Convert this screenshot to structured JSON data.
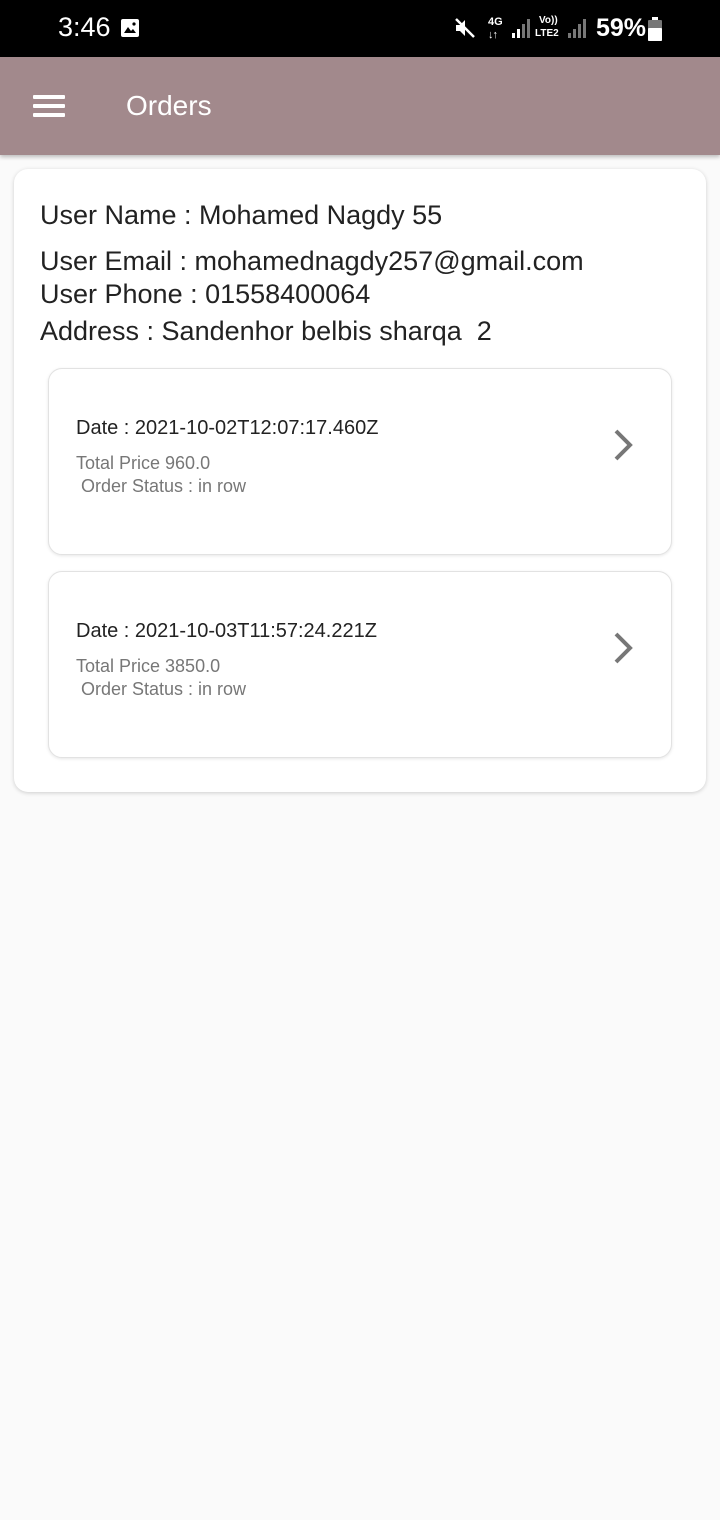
{
  "status_bar": {
    "time": "3:46",
    "network_type": "4G",
    "network_arrows": "↓↑",
    "volte_top": "Vo))",
    "volte_bottom": "LTE2",
    "battery": "59%",
    "icons": [
      "gallery-icon",
      "mute-icon",
      "signal-icon",
      "battery-icon"
    ]
  },
  "app_bar": {
    "title": "Orders",
    "menu_icon": "hamburger-menu-icon",
    "color": "#a2898c"
  },
  "user": {
    "name_line": "User Name : Mohamed Nagdy 55",
    "email_line": "User Email : mohamednagdy257@gmail.com",
    "phone_line": "User Phone : 01558400064",
    "address_line": "Address : Sandenhor belbis sharqa  2"
  },
  "orders": [
    {
      "date": "Date : 2021-10-02T12:07:17.460Z",
      "price": "Total Price 960.0",
      "status": " Order Status : in row",
      "icon": "chevron-right-icon"
    },
    {
      "date": "Date : 2021-10-03T11:57:24.221Z",
      "price": "Total Price 3850.0",
      "status": " Order Status : in row",
      "icon": "chevron-right-icon"
    }
  ]
}
